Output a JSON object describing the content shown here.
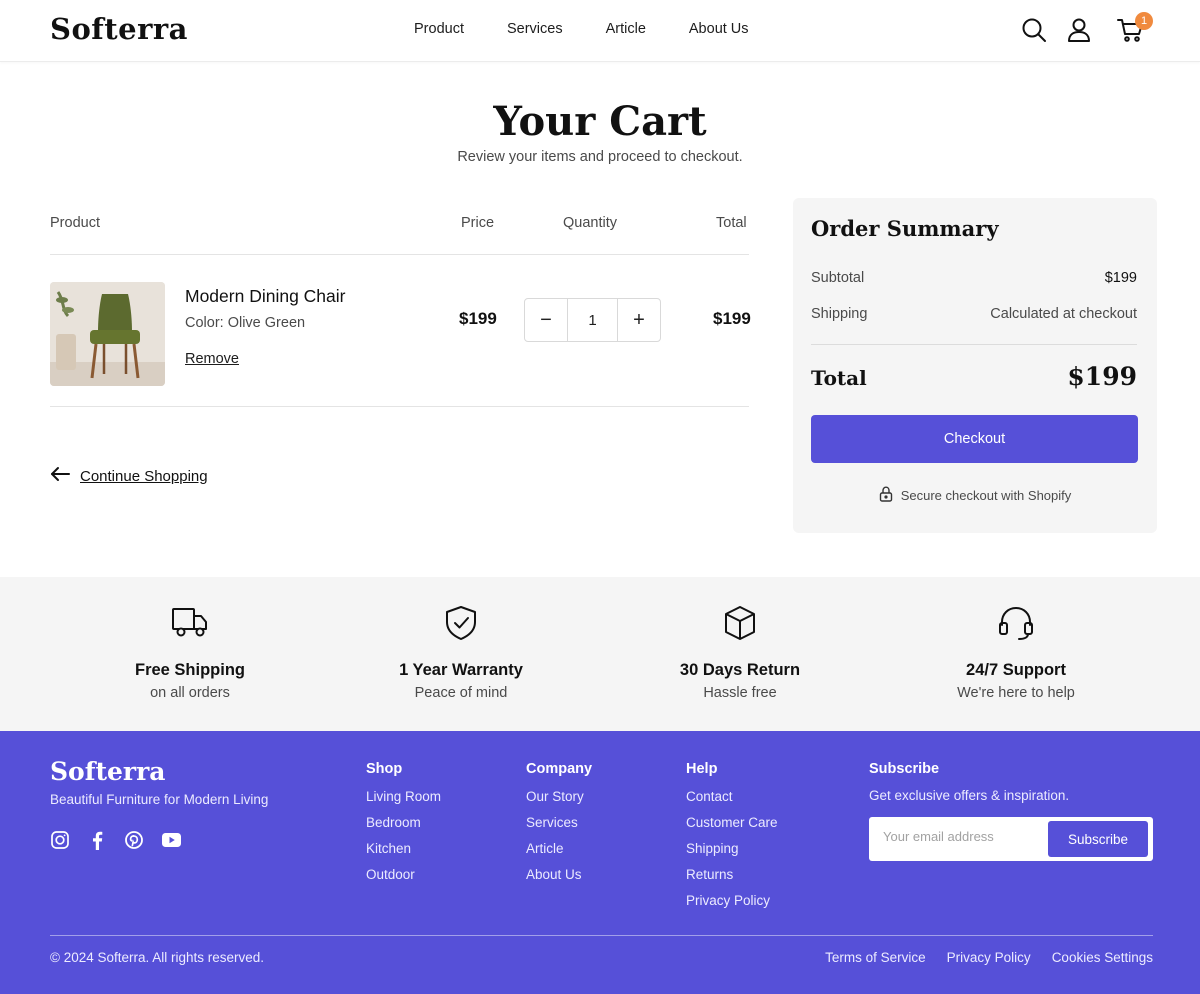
{
  "brand": {
    "name": "Softerra",
    "accent": "#5650d8",
    "badge_color": "#f08a3e"
  },
  "nav": {
    "items": [
      "Product",
      "Services",
      "Article",
      "About Us"
    ]
  },
  "header_icons": {
    "search": "search-icon",
    "account": "user-icon",
    "cart": "cart-icon",
    "cart_count": "1"
  },
  "page": {
    "title": "Your Cart",
    "subtitle": "Review your items and proceed to checkout."
  },
  "cart": {
    "columns": {
      "product": "Product",
      "price": "Price",
      "quantity": "Quantity",
      "total": "Total"
    },
    "items": [
      {
        "name": "Modern Dining Chair",
        "variant": "Color: Olive Green",
        "price": "$199",
        "quantity": "1",
        "total": "$199",
        "remove_label": "Remove"
      }
    ],
    "decrement": "−",
    "increment": "+",
    "continue_label": "Continue Shopping"
  },
  "summary": {
    "title": "Order Summary",
    "subtotal_label": "Subtotal",
    "subtotal_value": "$199",
    "shipping_label": "Shipping",
    "shipping_value": "Calculated at checkout",
    "total_label": "Total",
    "total_value": "$199",
    "checkout_label": "Checkout",
    "secure_text": "Secure checkout with Shopify"
  },
  "features": [
    {
      "icon": "truck-icon",
      "title": "Free Shipping",
      "subtitle": "on all orders"
    },
    {
      "icon": "shield-check-icon",
      "title": "1 Year Warranty",
      "subtitle": "Peace of mind"
    },
    {
      "icon": "box-icon",
      "title": "30 Days Return",
      "subtitle": "Hassle free"
    },
    {
      "icon": "headset-icon",
      "title": "24/7 Support",
      "subtitle": "We're here to help"
    }
  ],
  "footer": {
    "logo": "Softerra",
    "tagline": "Beautiful Furniture for Modern Living",
    "social": [
      "instagram-icon",
      "facebook-icon",
      "pinterest-icon",
      "youtube-icon"
    ],
    "columns": [
      {
        "heading": "Shop",
        "links": [
          "Living Room",
          "Bedroom",
          "Kitchen",
          "Outdoor"
        ]
      },
      {
        "heading": "Company",
        "links": [
          "Our Story",
          "Services",
          "Article",
          "About Us"
        ]
      },
      {
        "heading": "Help",
        "links": [
          "Contact",
          "Customer Care",
          "Shipping",
          "Returns",
          "Privacy Policy"
        ]
      }
    ],
    "subscribe": {
      "heading": "Subscribe",
      "description": "Get exclusive offers & inspiration.",
      "placeholder": "Your email address",
      "button": "Subscribe"
    },
    "copyright": "© 2024 Softerra. All rights reserved.",
    "legal": [
      "Terms of Service",
      "Privacy Policy",
      "Cookies Settings"
    ]
  }
}
